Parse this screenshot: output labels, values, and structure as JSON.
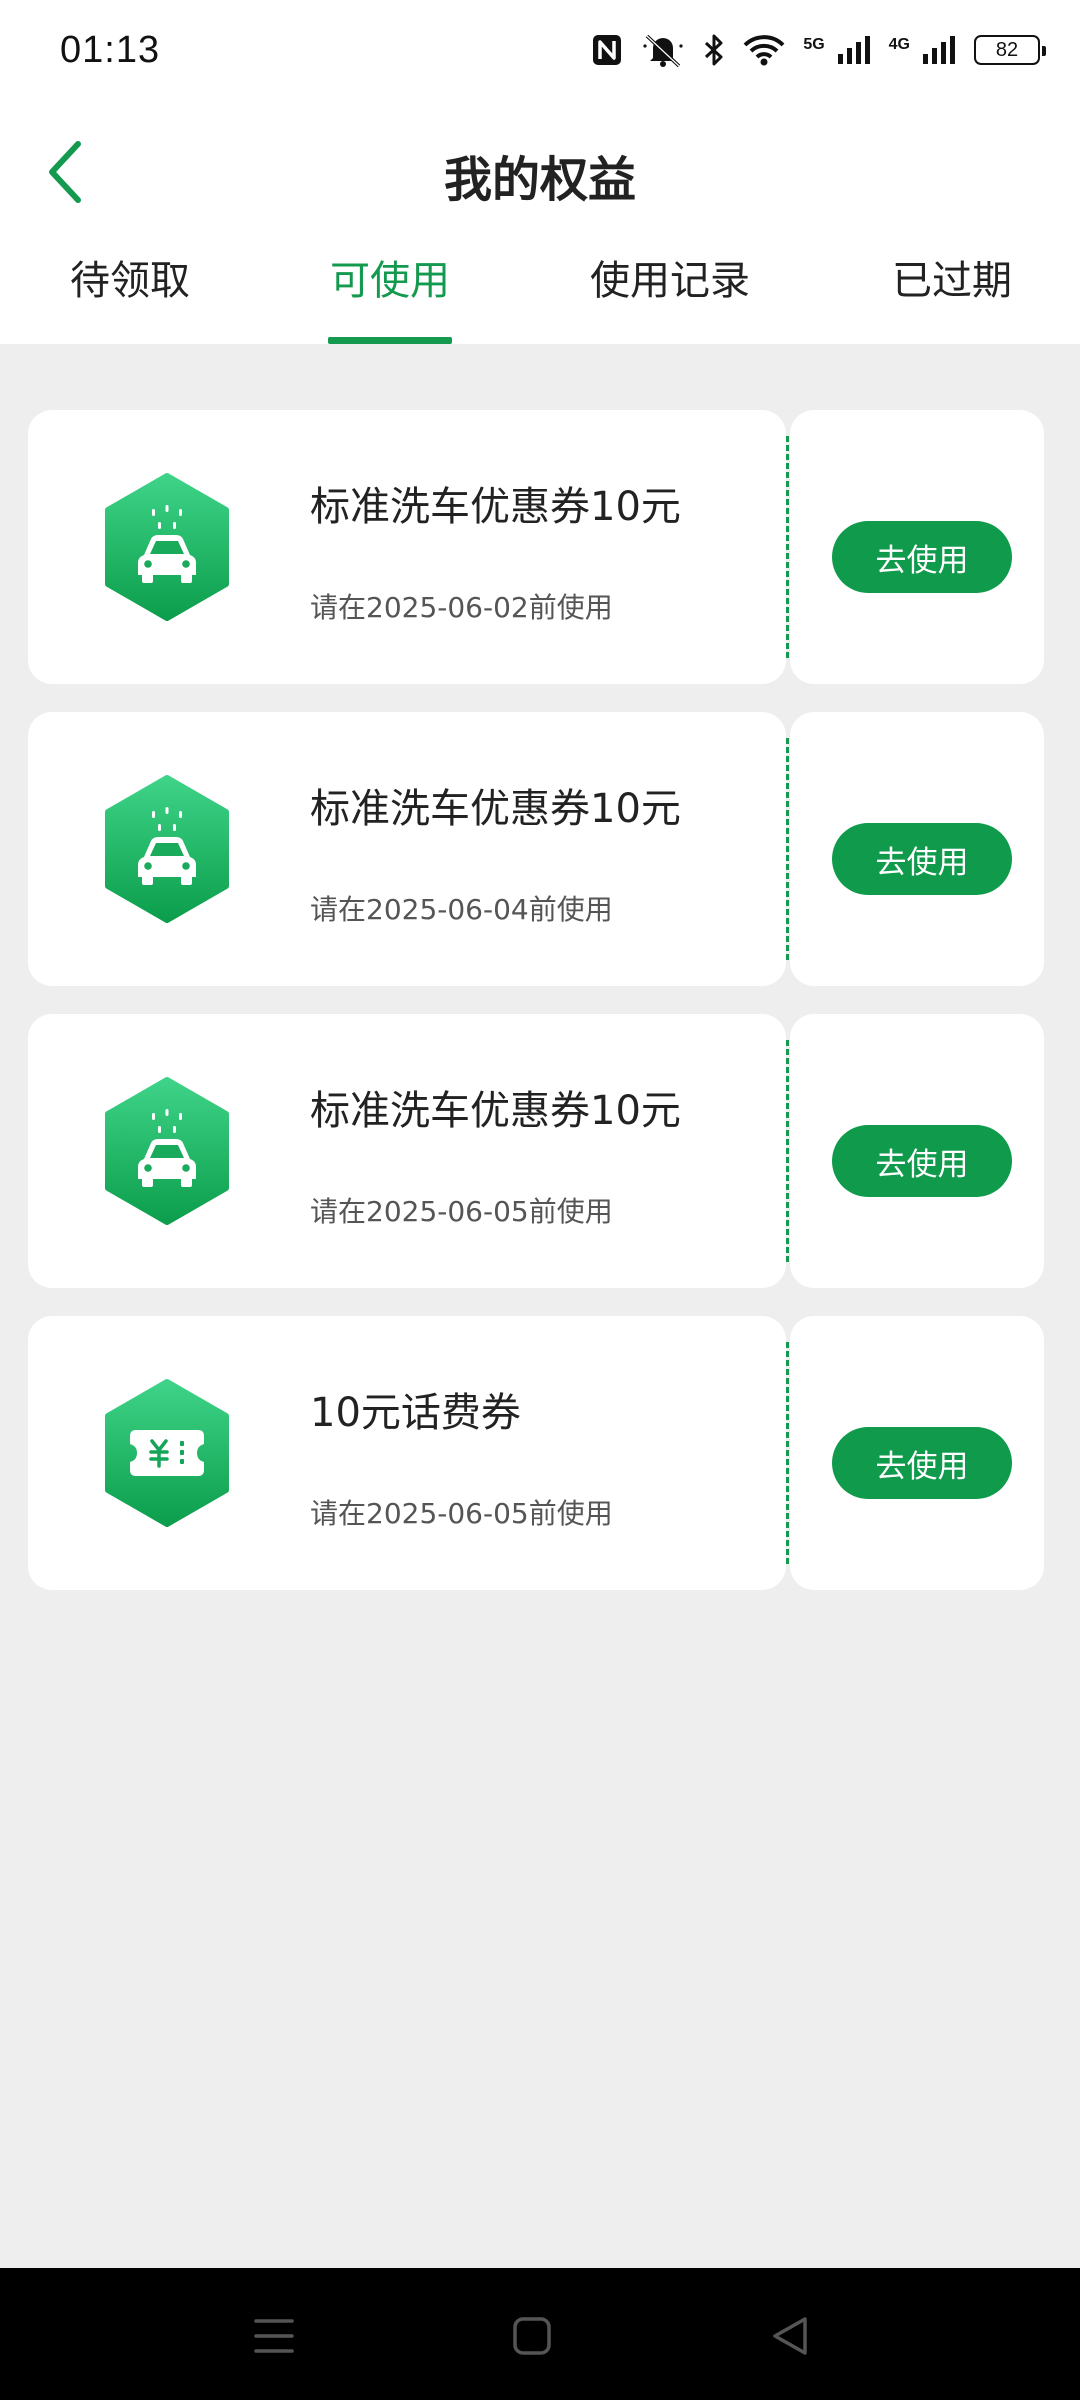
{
  "status_bar": {
    "time": "01:13",
    "net1": "5G",
    "net2": "4G",
    "battery": "82",
    "icons": [
      "nfc-icon",
      "mute-icon",
      "bluetooth-icon",
      "wifi-icon",
      "signal-icon",
      "battery-icon"
    ]
  },
  "header": {
    "title": "我的权益",
    "back_icon": "chevron-left-icon"
  },
  "tabs": [
    {
      "label": "待领取",
      "active": false
    },
    {
      "label": "可使用",
      "active": true
    },
    {
      "label": "使用记录",
      "active": false
    },
    {
      "label": "已过期",
      "active": false
    }
  ],
  "coupons": [
    {
      "icon": "car-wash-icon",
      "title": "标准洗车优惠券10元",
      "expiry": "请在2025-06-02前使用",
      "button": "去使用"
    },
    {
      "icon": "car-wash-icon",
      "title": "标准洗车优惠券10元",
      "expiry": "请在2025-06-04前使用",
      "button": "去使用"
    },
    {
      "icon": "car-wash-icon",
      "title": "标准洗车优惠券10元",
      "expiry": "请在2025-06-05前使用",
      "button": "去使用"
    },
    {
      "icon": "ticket-yuan-icon",
      "title": "10元话费券",
      "expiry": "请在2025-06-05前使用",
      "button": "去使用"
    }
  ],
  "colors": {
    "accent": "#149a4f",
    "button": "#0f9a4c",
    "background": "#eeeeee"
  },
  "nav": [
    "menu-icon",
    "home-icon",
    "back-icon"
  ]
}
